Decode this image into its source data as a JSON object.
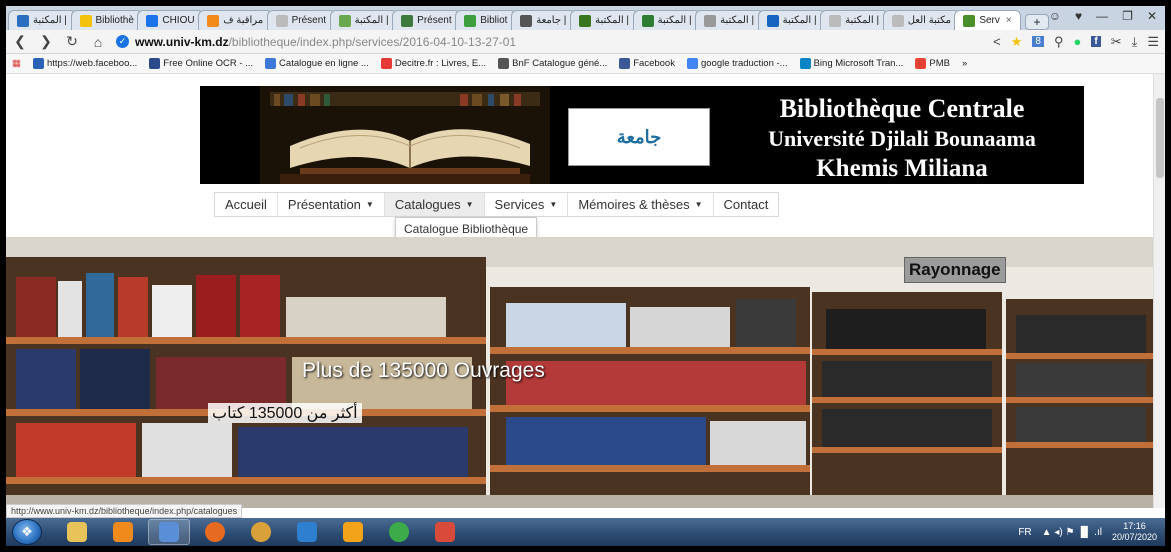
{
  "browser": {
    "tabs": [
      {
        "label": "المكتبة |",
        "color": "#2a6fbf"
      },
      {
        "label": "Bibliothè",
        "color": "#f2c20c"
      },
      {
        "label": "CHIOU",
        "color": "#1a73e8"
      },
      {
        "label": "مراقبة ف",
        "color": "#f28a1a"
      },
      {
        "label": "Présent",
        "color": "#bbbbbb"
      },
      {
        "label": "المكتبة |",
        "color": "#6aa84f"
      },
      {
        "label": "Présent",
        "color": "#3d7a3d"
      },
      {
        "label": "Bibliot",
        "color": "#3c9e3c"
      },
      {
        "label": "جامعة |",
        "color": "#555555"
      },
      {
        "label": "المكتبة |",
        "color": "#38761d"
      },
      {
        "label": "المكتبة |",
        "color": "#2e7d32"
      },
      {
        "label": "المكتبة |",
        "color": "#999999"
      },
      {
        "label": "المكتبة |",
        "color": "#1565c0"
      },
      {
        "label": "المكتبة |",
        "color": "#bbbbbb"
      },
      {
        "label": "مكتبة العل",
        "color": "#bbbbbb"
      },
      {
        "label": "Serv",
        "color": "#4a8f2a",
        "active": true
      }
    ],
    "newtab_label": "+",
    "window_controls": [
      "☺",
      "♥",
      "—",
      "❐",
      "✕"
    ],
    "url_host": "www.univ-km.dz",
    "url_path": "/bibliotheque/index.php/services/2016-04-10-13-27-01",
    "bookmarks": [
      {
        "label": "https://web.faceboo...",
        "color": "#2a62b8"
      },
      {
        "label": "Free Online OCR - ...",
        "color": "#2b4a8a"
      },
      {
        "label": "Catalogue en ligne ...",
        "color": "#3c78d8"
      },
      {
        "label": "Decitre.fr : Livres, E...",
        "color": "#e53935"
      },
      {
        "label": "BnF Catalogue géné...",
        "color": "#555555"
      },
      {
        "label": "Facebook",
        "color": "#3b5998"
      },
      {
        "label": "google traduction -...",
        "color": "#4285f4"
      },
      {
        "label": "Bing Microsoft Tran...",
        "color": "#0a84c4"
      },
      {
        "label": "PMB",
        "color": "#ea4335"
      }
    ],
    "bookmark_more": "»",
    "status_url": "http://www.univ-km.dz/bibliotheque/index.php/catalogues"
  },
  "banner": {
    "logo_text": "جامعة",
    "title_line1": "Bibliothèque  Centrale",
    "title_line2": "Université  Djilali Bounaama",
    "title_line3": "Khemis Miliana"
  },
  "menu": {
    "items": [
      {
        "label": "Accueil",
        "has_caret": false
      },
      {
        "label": "Présentation",
        "has_caret": true
      },
      {
        "label": "Catalogues",
        "has_caret": true,
        "hover": true
      },
      {
        "label": "Services",
        "has_caret": true
      },
      {
        "label": "Mémoires & thèses",
        "has_caret": true
      },
      {
        "label": "Contact",
        "has_caret": false
      }
    ],
    "dropdown_item": "Catalogue Bibliothèque"
  },
  "hero": {
    "badge": "Rayonnage",
    "caption_fr": "Plus de 135000 Ouvrages",
    "caption_ar": "أكثر من 135000 كتاب"
  },
  "taskbar": {
    "icons": [
      {
        "name": "explorer",
        "color": "#e7c35a"
      },
      {
        "name": "vlc",
        "color": "#f08a1a"
      },
      {
        "name": "app-s",
        "color": "#5a8fd8",
        "active": true
      },
      {
        "name": "firefox",
        "color": "#e66a1f"
      },
      {
        "name": "paint",
        "color": "#d9a13a"
      },
      {
        "name": "media",
        "color": "#2f7fd0"
      },
      {
        "name": "search",
        "color": "#f2a31a"
      },
      {
        "name": "chrome",
        "color": "#3cab4a"
      },
      {
        "name": "loading",
        "color": "#d84a3a"
      }
    ],
    "lang": "FR",
    "tray_icons": "▲  ◂)  ⚑  ▐▌  .ıl",
    "time": "17:16",
    "date": "20/07/2020"
  }
}
